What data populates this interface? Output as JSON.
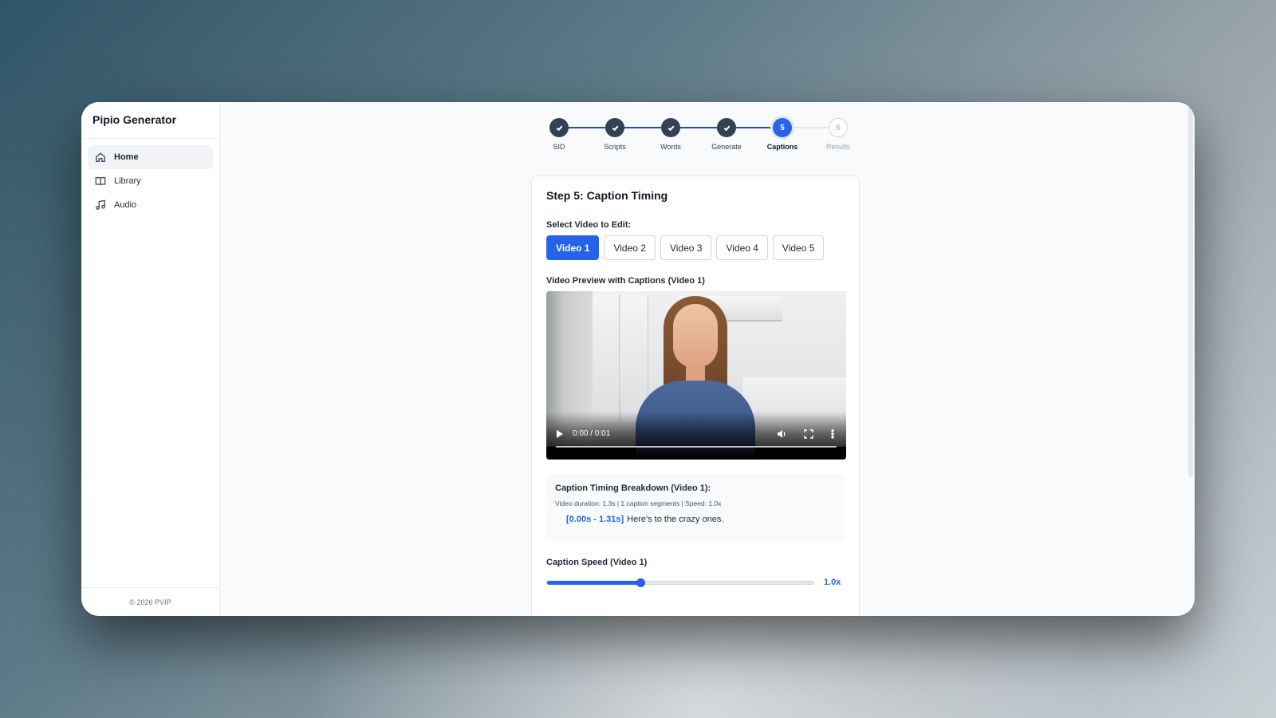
{
  "app": {
    "title": "Pipio Generator",
    "footer": "© 2026 PVIP"
  },
  "sidebar": {
    "items": [
      {
        "label": "Home",
        "icon": "home-icon",
        "active": true
      },
      {
        "label": "Library",
        "icon": "book-icon",
        "active": false
      },
      {
        "label": "Audio",
        "icon": "music-icon",
        "active": false
      }
    ]
  },
  "stepper": {
    "steps": [
      {
        "label": "SID",
        "state": "done",
        "marker": ""
      },
      {
        "label": "Scripts",
        "state": "done",
        "marker": ""
      },
      {
        "label": "Words",
        "state": "done",
        "marker": ""
      },
      {
        "label": "Generate",
        "state": "done",
        "marker": ""
      },
      {
        "label": "Captions",
        "state": "current",
        "marker": "5"
      },
      {
        "label": "Results",
        "state": "pending",
        "marker": "6"
      }
    ]
  },
  "card": {
    "title": "Step 5: Caption Timing",
    "select_label": "Select Video to Edit:",
    "video_tabs": [
      "Video 1",
      "Video 2",
      "Video 3",
      "Video 4",
      "Video 5"
    ],
    "active_tab": 0,
    "preview_label": "Video Preview with Captions (Video 1)",
    "player": {
      "time": "0:00 / 0:01"
    },
    "breakdown": {
      "title": "Caption Timing Breakdown (Video 1):",
      "meta": "Video duration: 1.3s | 1 caption segments | Speed: 1.0x",
      "segments": [
        {
          "time": "[0.00s - 1.31s]",
          "text": "Here's to the crazy ones."
        }
      ]
    },
    "speed": {
      "label": "Caption Speed (Video 1)",
      "value_text": "1.0x",
      "fraction": 0.35
    }
  },
  "colors": {
    "accent": "#2563eb",
    "done": "#334155",
    "pending": "#9ca3af"
  }
}
